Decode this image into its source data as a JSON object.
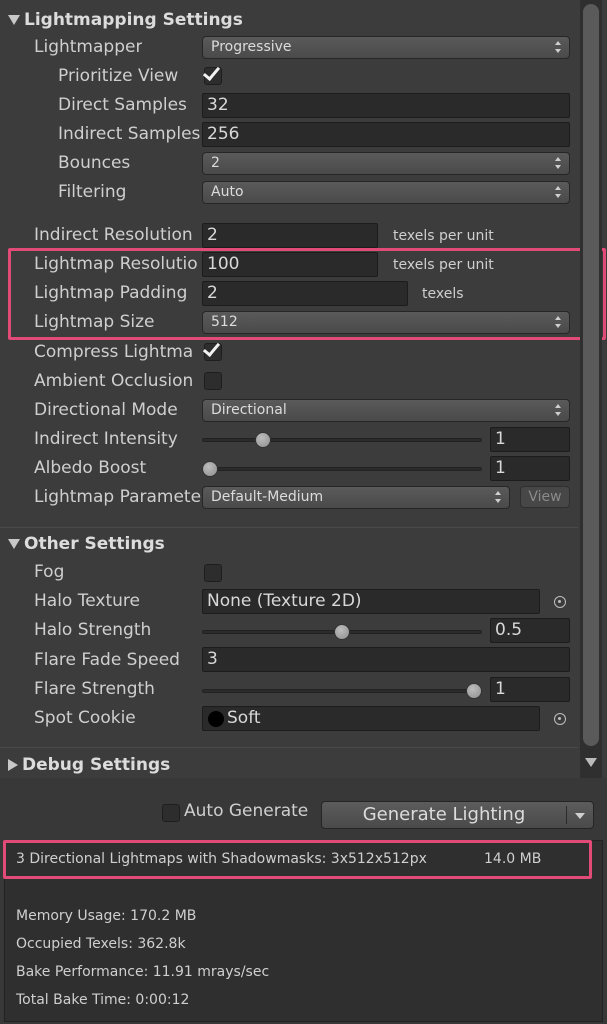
{
  "lightmapping": {
    "header": "Lightmapping Settings",
    "lightmapper_label": "Lightmapper",
    "lightmapper_value": "Progressive",
    "prioritize_view_label": "Prioritize View",
    "direct_samples_label": "Direct Samples",
    "direct_samples_value": "32",
    "indirect_samples_label": "Indirect Samples",
    "indirect_samples_value": "256",
    "bounces_label": "Bounces",
    "bounces_value": "2",
    "filtering_label": "Filtering",
    "filtering_value": "Auto",
    "indirect_resolution_label": "Indirect Resolution",
    "indirect_resolution_value": "2",
    "indirect_resolution_unit": "texels per unit",
    "lightmap_resolution_label": "Lightmap Resolutio",
    "lightmap_resolution_value": "100",
    "lightmap_resolution_unit": "texels per unit",
    "lightmap_padding_label": "Lightmap Padding",
    "lightmap_padding_value": "2",
    "lightmap_padding_unit": "texels",
    "lightmap_size_label": "Lightmap Size",
    "lightmap_size_value": "512",
    "compress_label": "Compress Lightma",
    "ambient_occlusion_label": "Ambient Occlusion",
    "directional_mode_label": "Directional Mode",
    "directional_mode_value": "Directional",
    "indirect_intensity_label": "Indirect Intensity",
    "indirect_intensity_value": "1",
    "indirect_intensity_slider": 0.2,
    "albedo_boost_label": "Albedo Boost",
    "albedo_boost_value": "1",
    "albedo_boost_slider": 0.0,
    "lightmap_parameters_label": "Lightmap Paramete",
    "lightmap_parameters_value": "Default-Medium",
    "view_label": "View"
  },
  "other": {
    "header": "Other Settings",
    "fog_label": "Fog",
    "halo_texture_label": "Halo Texture",
    "halo_texture_value": "None (Texture 2D)",
    "halo_strength_label": "Halo Strength",
    "halo_strength_value": "0.5",
    "halo_strength_slider": 0.5,
    "flare_fade_label": "Flare Fade Speed",
    "flare_fade_value": "3",
    "flare_strength_label": "Flare Strength",
    "flare_strength_value": "1",
    "flare_strength_slider": 1.0,
    "spot_cookie_label": "Spot Cookie",
    "spot_cookie_value": "Soft"
  },
  "debug": {
    "header": "Debug Settings"
  },
  "bottom": {
    "auto_generate_label": "Auto Generate",
    "generate_label": "Generate Lighting",
    "lightmaps_summary": "3 Directional Lightmaps with Shadowmasks: 3x512x512px",
    "lightmaps_size": "14.0 MB",
    "memory_usage": "Memory Usage: 170.2 MB",
    "occupied_texels": "Occupied Texels: 362.8k",
    "bake_performance": "Bake Performance: 11.91 mrays/sec",
    "total_bake_time": "Total Bake Time: 0:00:12"
  },
  "colors": {
    "highlight": "#e24a78",
    "panel": "#3c3c3c"
  }
}
